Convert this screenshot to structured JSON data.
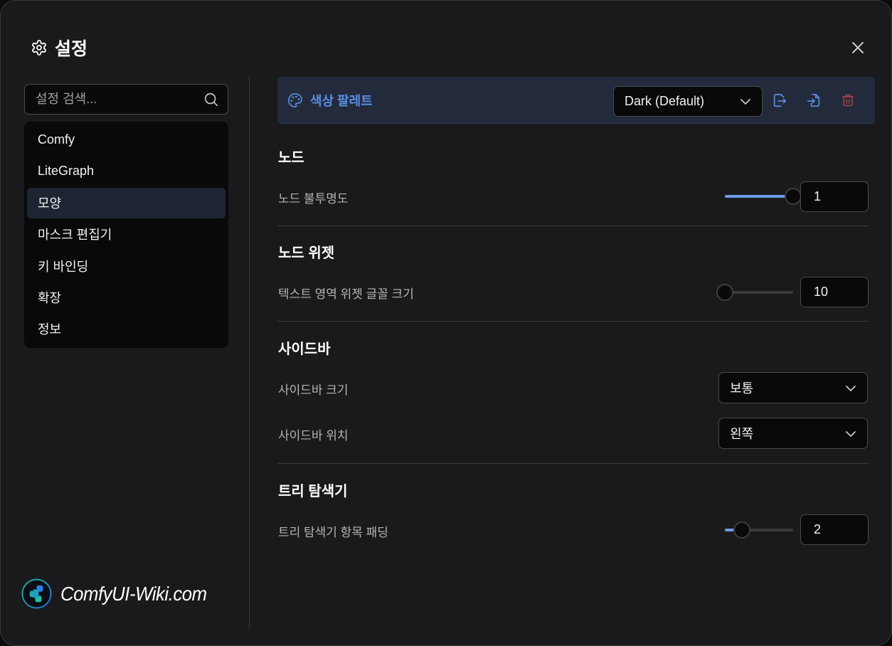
{
  "dialog": {
    "title": "설정",
    "title_icon": "gear-icon",
    "close_icon": "close-icon"
  },
  "sidebar": {
    "search": {
      "placeholder": "설정 검색...",
      "value": ""
    },
    "items": [
      {
        "label": "Comfy",
        "active": false
      },
      {
        "label": "LiteGraph",
        "active": false
      },
      {
        "label": "모양",
        "active": true
      },
      {
        "label": "마스크 편집기",
        "active": false
      },
      {
        "label": "키 바인딩",
        "active": false
      },
      {
        "label": "확장",
        "active": false
      },
      {
        "label": "정보",
        "active": false
      }
    ]
  },
  "brand": {
    "text": "ComfyUI-Wiki.com",
    "icon": "comfyui-logo-icon"
  },
  "palette": {
    "label": "색상 팔레트",
    "icon": "palette-icon",
    "selected": "Dark (Default)",
    "actions": [
      {
        "name": "export-palette",
        "icon": "file-export-icon",
        "color": "#5b8fe0"
      },
      {
        "name": "import-palette",
        "icon": "file-import-icon",
        "color": "#5b8fe0"
      },
      {
        "name": "delete-palette",
        "icon": "trash-icon",
        "color": "#a8454a"
      }
    ],
    "accent": "#5b8fe0"
  },
  "sections": [
    {
      "title": "노드",
      "settings": [
        {
          "label": "노드 불투명도",
          "type": "slider",
          "value": "1",
          "fraction": 1.0
        }
      ]
    },
    {
      "title": "노드 위젯",
      "settings": [
        {
          "label": "텍스트 영역 위젯 글꼴 크기",
          "type": "slider",
          "value": "10",
          "fraction": 0.0
        }
      ]
    },
    {
      "title": "사이드바",
      "settings": [
        {
          "label": "사이드바 크기",
          "type": "dropdown",
          "value": "보통"
        },
        {
          "label": "사이드바 위치",
          "type": "dropdown",
          "value": "왼쪽"
        }
      ]
    },
    {
      "title": "트리 탐색기",
      "settings": [
        {
          "label": "트리 탐색기 항목 패딩",
          "type": "slider",
          "value": "2",
          "fraction": 0.25
        }
      ]
    }
  ],
  "colors": {
    "accent": "#6a9be6",
    "background": "#1a1a1c",
    "active_nav": "#1e2532",
    "palette_bar": "#222a3c",
    "danger": "#a8454a"
  }
}
